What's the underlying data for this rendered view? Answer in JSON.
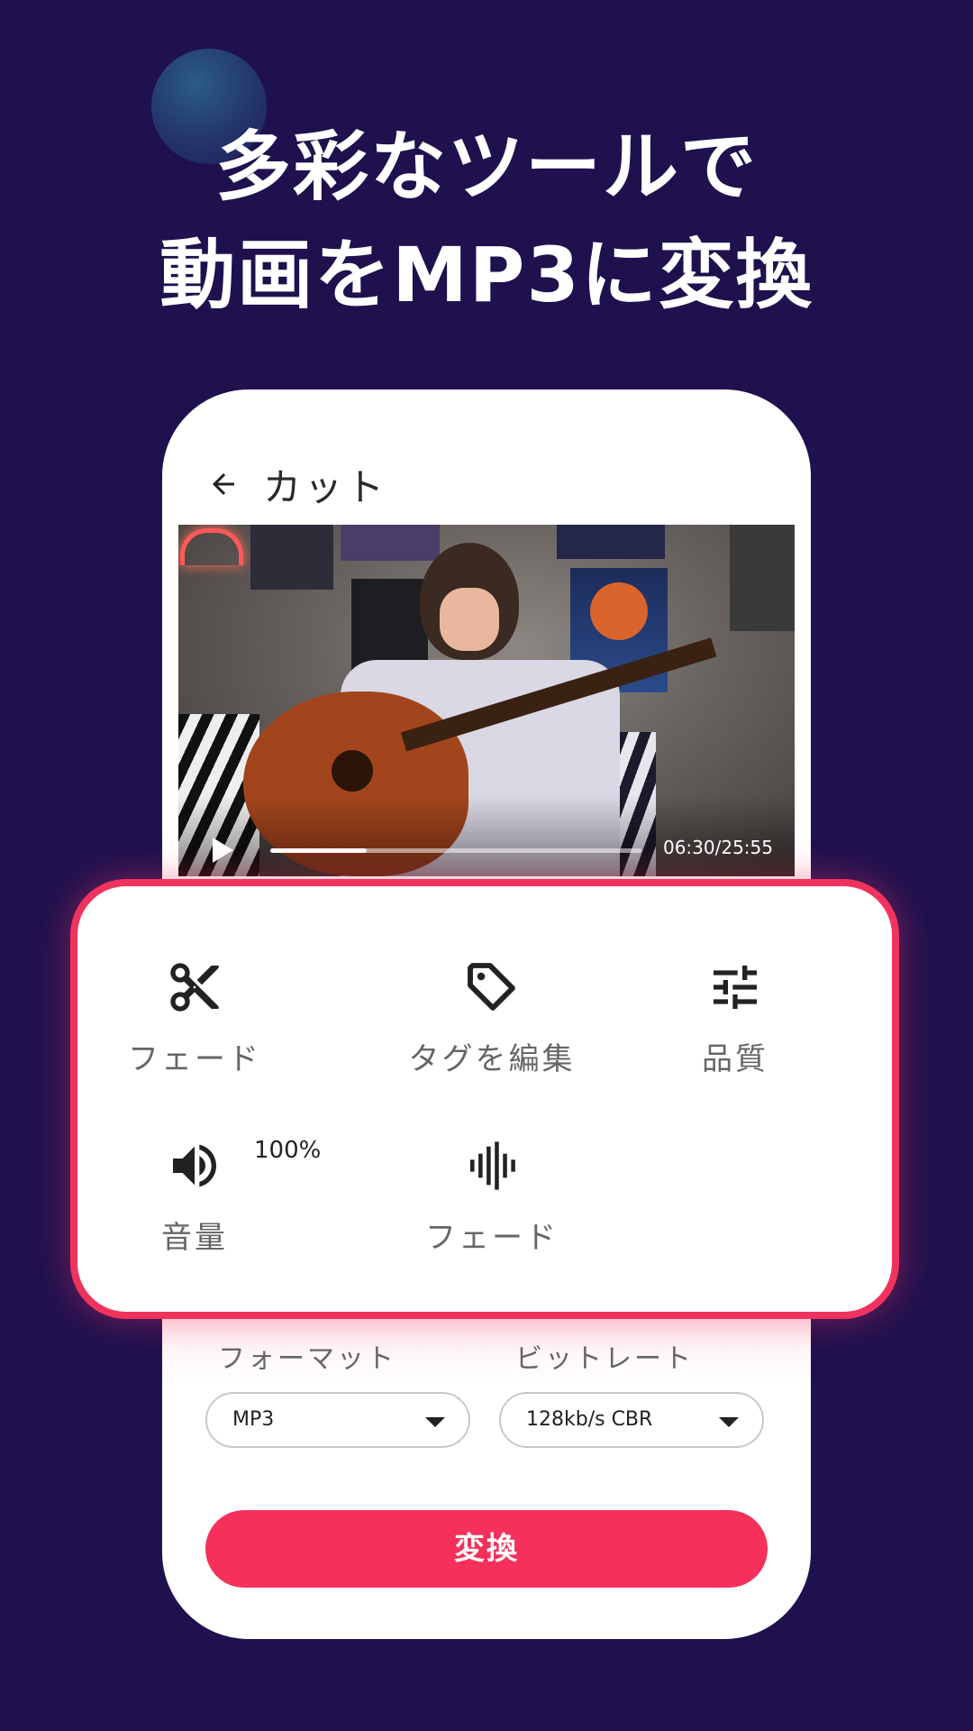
{
  "headline": {
    "line1": "多彩なツールで",
    "line2": "動画をMP3に変換"
  },
  "app_bar": {
    "back_icon": "arrow-left-icon",
    "title": "カット"
  },
  "player": {
    "play_icon": "play-icon",
    "time": "06:30/25:55",
    "progress_fraction": 0.26
  },
  "tools": [
    {
      "icon": "scissors-icon",
      "label": "フェード"
    },
    {
      "icon": "tag-icon",
      "label": "タグを編集"
    },
    {
      "icon": "sliders-icon",
      "label": "品質"
    },
    {
      "icon": "volume-icon",
      "label": "音量",
      "badge": "100%"
    },
    {
      "icon": "waveform-icon",
      "label": "フェード"
    }
  ],
  "format": {
    "label": "フォーマット",
    "value": "MP3"
  },
  "bitrate": {
    "label": "ビットレート",
    "value": "128kb/s CBR"
  },
  "convert_button": "変換",
  "colors": {
    "background": "#1f114e",
    "accent": "#f5305a",
    "panel_border": "#f0335e"
  }
}
